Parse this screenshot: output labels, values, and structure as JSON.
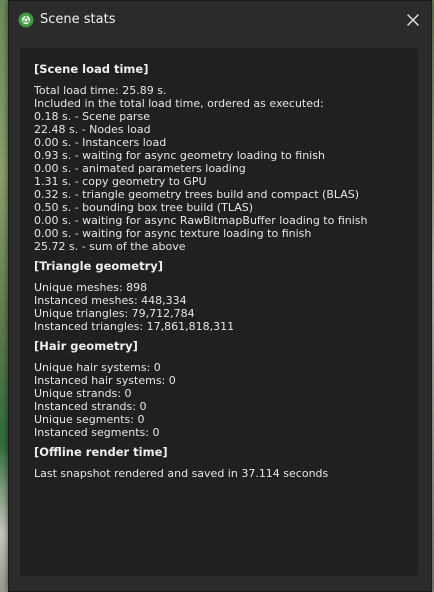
{
  "window": {
    "title": "Scene stats",
    "close_label": "×"
  },
  "sections": [
    {
      "heading": "[Scene load time]",
      "lines": [
        "Total load time: 25.89 s.",
        "Included in the total load time, ordered as executed:",
        "0.18 s. - Scene parse",
        "22.48 s. - Nodes load",
        "0.00 s. - Instancers load",
        "0.93 s. - waiting for async geometry loading to finish",
        "0.00 s. - animated parameters loading",
        "1.31 s. - copy geometry to GPU",
        "0.32 s. - triangle geometry trees build and compact (BLAS)",
        "0.50 s. - bounding box tree build (TLAS)",
        "0.00 s. - waiting for async RawBitmapBuffer loading to finish",
        "0.00 s. - waiting for async texture loading to finish",
        "25.72 s. - sum of the above"
      ]
    },
    {
      "heading": "[Triangle geometry]",
      "lines": [
        "Unique meshes: 898",
        "Instanced meshes: 448,334",
        "Unique triangles: 79,712,784",
        "Instanced triangles: 17,861,818,311"
      ]
    },
    {
      "heading": "[Hair geometry]",
      "lines": [
        "Unique hair systems: 0",
        "Instanced hair systems: 0",
        "Unique strands: 0",
        "Instanced strands: 0",
        "Unique segments: 0",
        "Instanced segments: 0"
      ]
    },
    {
      "heading": "[Offline render time]",
      "lines": [
        "Last snapshot rendered and saved in 37.114 seconds"
      ]
    }
  ],
  "colors": {
    "window_bg": "#2b2b2b",
    "panel_bg": "#202020",
    "text": "#e6e6e6",
    "icon_green": "#3d9a3d"
  },
  "icons": {
    "app": "app-logo-icon",
    "close": "close-icon"
  }
}
